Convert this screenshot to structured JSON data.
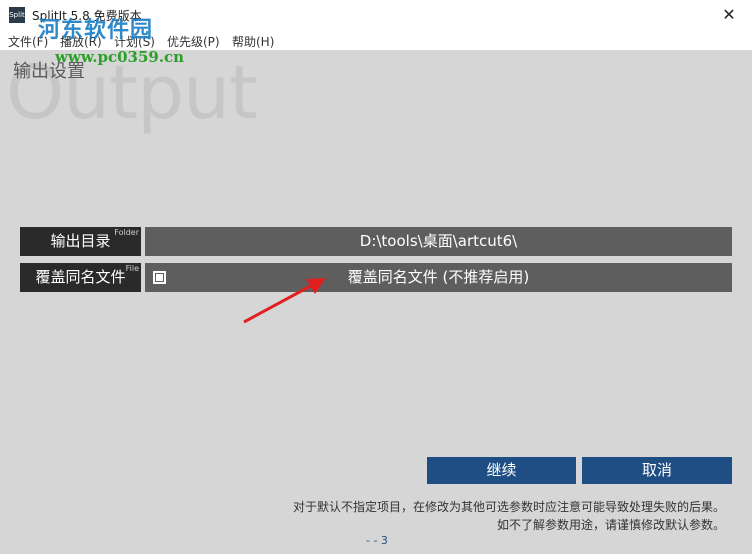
{
  "window": {
    "title": "SplitIt 5.8 免费版本",
    "app_icon_text": "Split",
    "close_glyph": "✕"
  },
  "menu": {
    "items": [
      "文件(F)",
      "播放(R)",
      "计划(S)",
      "优先级(P)",
      "帮助(H)"
    ]
  },
  "watermark": {
    "logo_text": "河东软件园",
    "url": "www.pc0359.cn"
  },
  "section": {
    "background_word": "Output",
    "title": "输出设置"
  },
  "rows": {
    "output_dir": {
      "label": "输出目录",
      "tag": "Folder",
      "value": "D:\\tools\\桌面\\artcut6\\"
    },
    "overwrite": {
      "label": "覆盖同名文件",
      "tag": "File",
      "value": "覆盖同名文件 (不推荐启用)",
      "checked": false
    }
  },
  "buttons": {
    "continue": "继续",
    "cancel": "取消"
  },
  "notes": {
    "line1": "对于默认不指定项目，在修改为其他可选参数时应注意可能导致处理失败的后果。",
    "line2": "如不了解参数用途，请谨慎修改默认参数。"
  },
  "page_indicator": "- - 3",
  "colors": {
    "accent": "#1f4e85",
    "label_bg": "#2a2a2a",
    "value_bg": "#5e5e5e",
    "annotation_arrow": "#e02020"
  }
}
